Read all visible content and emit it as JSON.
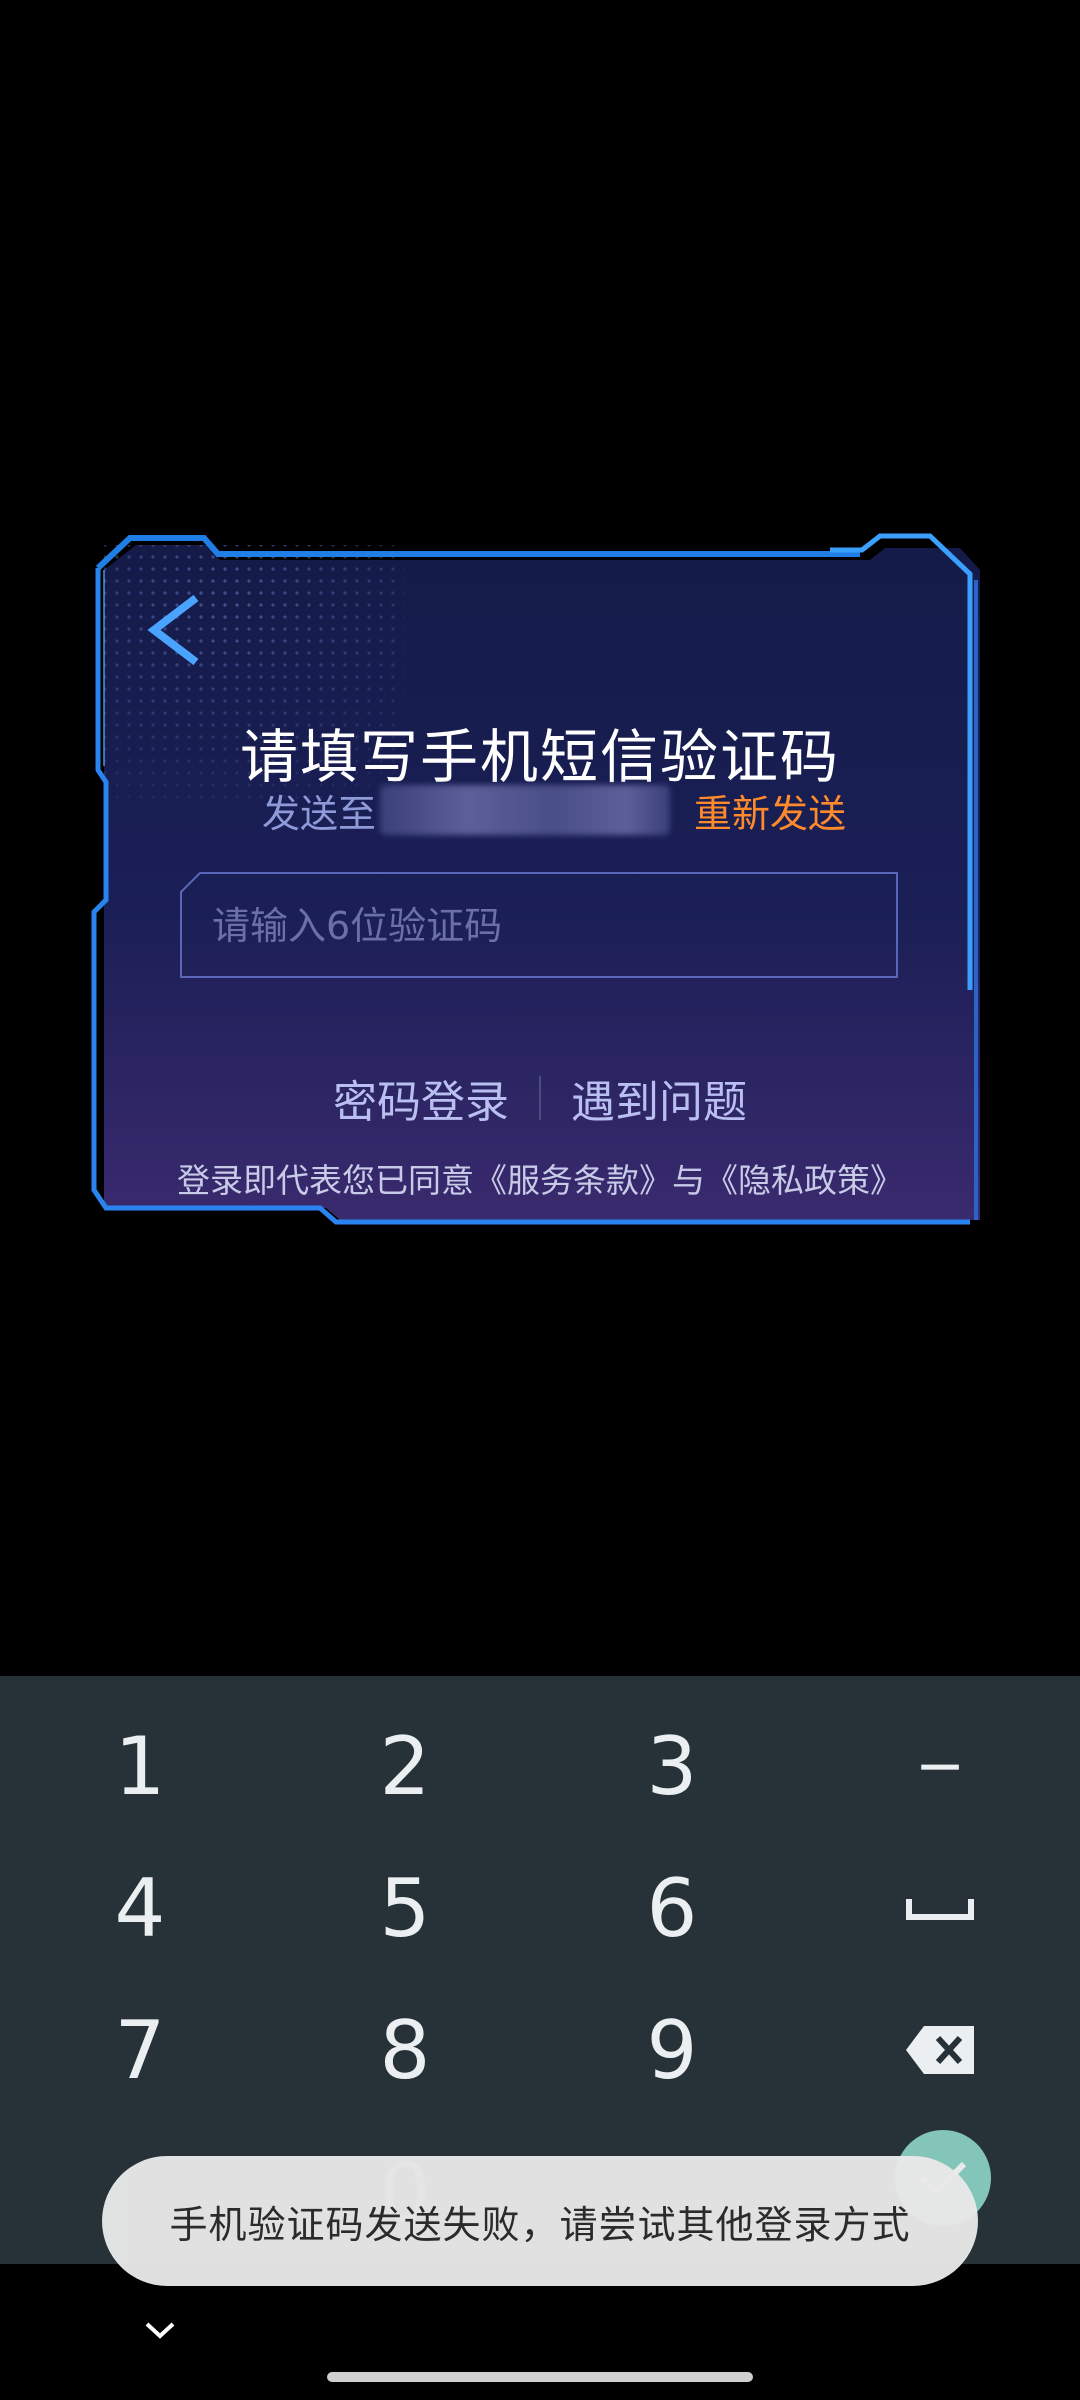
{
  "dialog": {
    "title": "请填写手机短信验证码",
    "send_prefix": "发送至",
    "resend_label": "重新发送",
    "code_placeholder": "请输入6位验证码",
    "password_login_label": "密码登录",
    "problem_label": "遇到问题",
    "agreement_text": "登录即代表您已同意《服务条款》与《隐私政策》",
    "back_icon": "chevron-left-icon"
  },
  "keyboard": {
    "keys": [
      "1",
      "2",
      "3",
      "−",
      "4",
      "5",
      "6",
      "␣",
      "7",
      "8",
      "9",
      "⌫",
      "0"
    ],
    "done_icon": "check-icon",
    "hide_icon": "chevron-down-icon"
  },
  "toast": {
    "message": "手机验证码发送失败，请尝试其他登录方式"
  },
  "colors": {
    "accent_orange": "#ff8a2b",
    "frame_blue": "#3aa0ff",
    "keyboard_bg": "#263238",
    "done_green": "#8fd6c9"
  }
}
